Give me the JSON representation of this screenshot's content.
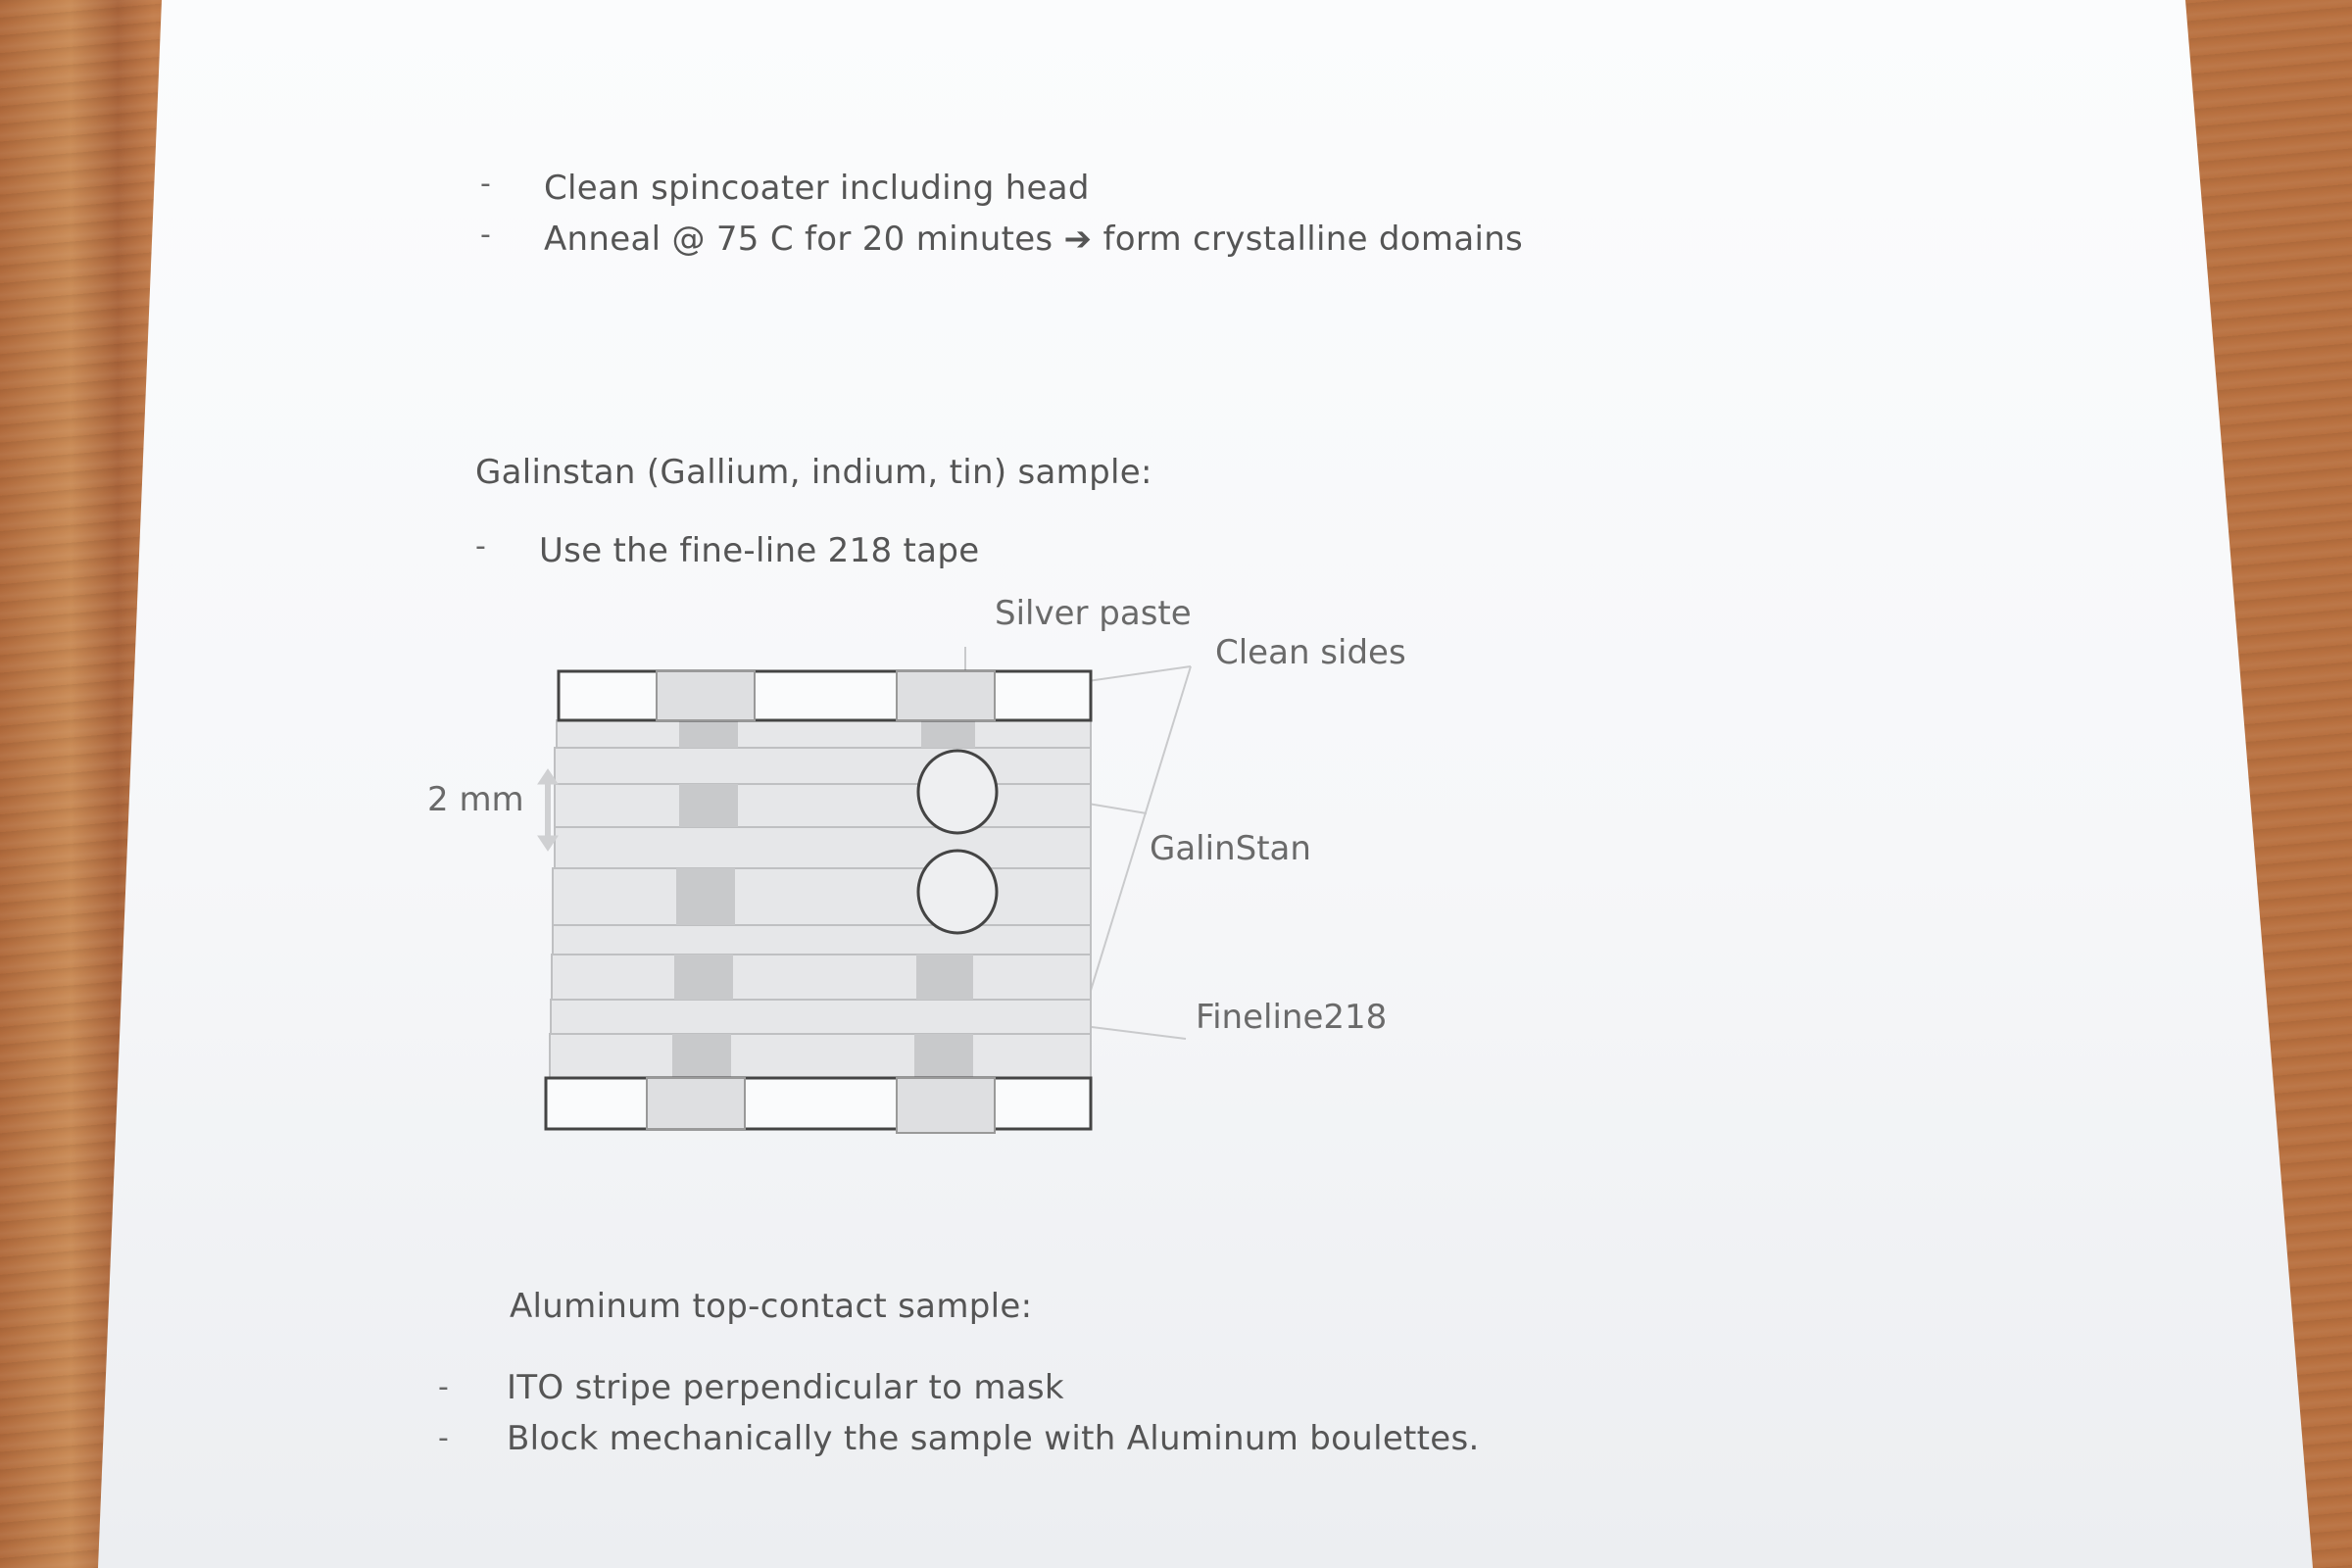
{
  "list1": [
    {
      "bullet": "-",
      "text": "Clean spincoater including head"
    },
    {
      "bullet": "-",
      "text": "Anneal @ 75 C for 20 minutes ➔ form crystalline domains"
    }
  ],
  "galinstan": {
    "heading": "Galinstan (Gallium, indium, tin) sample:",
    "items": [
      {
        "bullet": "-",
        "text": "Use the fine-line 218 tape"
      }
    ]
  },
  "diagram": {
    "label_silver_paste": "Silver paste",
    "label_clean_sides": "Clean sides",
    "label_scale": "2 mm",
    "label_galinstan": "GalinStan",
    "label_fineline": "Fineline218",
    "colors": {
      "outline": "#444444",
      "tape": "#e6e7e9",
      "dark_block": "#c8c9cb",
      "paste": "#dedfe1"
    }
  },
  "aluminum": {
    "heading": "Aluminum top-contact sample:",
    "items": [
      {
        "bullet": "-",
        "text": "ITO stripe perpendicular to mask"
      },
      {
        "bullet": "-",
        "text": "Block mechanically the sample with Aluminum boulettes."
      }
    ]
  }
}
